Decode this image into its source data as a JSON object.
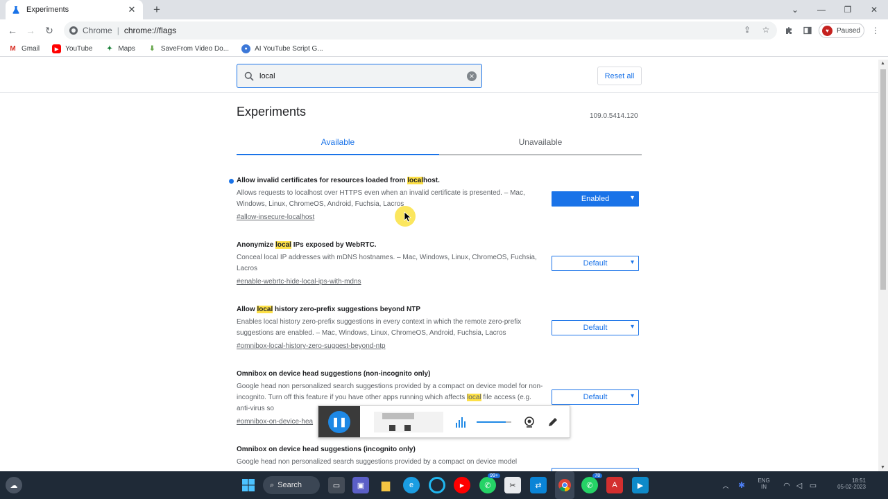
{
  "browser": {
    "tab_title": "Experiments",
    "omnibox_site": "Chrome",
    "omnibox_separator": "|",
    "url": "chrome://flags",
    "profile_label": "Paused"
  },
  "bookmarks": [
    {
      "label": "Gmail",
      "icon": "gmail-icon"
    },
    {
      "label": "YouTube",
      "icon": "youtube-icon"
    },
    {
      "label": "Maps",
      "icon": "maps-icon"
    },
    {
      "label": "SaveFrom Video Do...",
      "icon": "savefrom-icon"
    },
    {
      "label": "AI YouTube Script G...",
      "icon": "ai-script-icon"
    }
  ],
  "search": {
    "value": "local"
  },
  "reset_label": "Reset all",
  "page_title": "Experiments",
  "version": "109.0.5414.120",
  "tabs": {
    "available": "Available",
    "unavailable": "Unavailable"
  },
  "experiments": [
    {
      "name_pre": "Allow invalid certificates for resources loaded from ",
      "name_hl": "local",
      "name_post": "host.",
      "desc_pre": "Allows requests to localhost over HTTPS even when an invalid certificate is presented. – Mac, Windows, Linux, ChromeOS, Android, Fuchsia, Lacros",
      "desc_hl": "",
      "desc_post": "",
      "link": "#allow-insecure-localhost",
      "state": "Enabled"
    },
    {
      "name_pre": "Anonymize ",
      "name_hl": "local",
      "name_post": " IPs exposed by WebRTC.",
      "desc_pre": "Conceal local IP addresses with mDNS hostnames. – Mac, Windows, Linux, ChromeOS, Fuchsia, Lacros",
      "desc_hl": "",
      "desc_post": "",
      "link": "#enable-webrtc-hide-local-ips-with-mdns",
      "state": "Default"
    },
    {
      "name_pre": "Allow ",
      "name_hl": "local",
      "name_post": " history zero-prefix suggestions beyond NTP",
      "desc_pre": "Enables local history zero-prefix suggestions in every context in which the remote zero-prefix suggestions are enabled. – Mac, Windows, Linux, ChromeOS, Android, Fuchsia, Lacros",
      "desc_hl": "",
      "desc_post": "",
      "link": "#omnibox-local-history-zero-suggest-beyond-ntp",
      "state": "Default"
    },
    {
      "name_pre": "Omnibox on device head suggestions (non-incognito only)",
      "name_hl": "",
      "name_post": "",
      "desc_pre": "Google head non personalized search suggestions provided by a compact on device model for non-incognito. Turn off this feature if you have other apps running which affects ",
      "desc_hl": "local",
      "desc_post": " file access (e.g. anti-virus so",
      "link": "#omnibox-on-device-hea",
      "state": "Default"
    },
    {
      "name_pre": "Omnibox on device head suggestions (incognito only)",
      "name_hl": "",
      "name_post": "",
      "desc_pre": "Google head non personalized search suggestions provided by a compact on device model",
      "desc_hl": "",
      "desc_post": "",
      "link": "",
      "state": ""
    }
  ],
  "taskbar": {
    "search_label": "Search",
    "whatsapp_badge": "99+",
    "whatsapp2_badge": "78",
    "lang_line1": "ENG",
    "lang_line2": "IN",
    "time": "18:51",
    "date": "05-02-2023"
  },
  "colors": {
    "accent": "#1a73e8",
    "highlight": "#fde047",
    "taskbar": "#1f2a37"
  }
}
